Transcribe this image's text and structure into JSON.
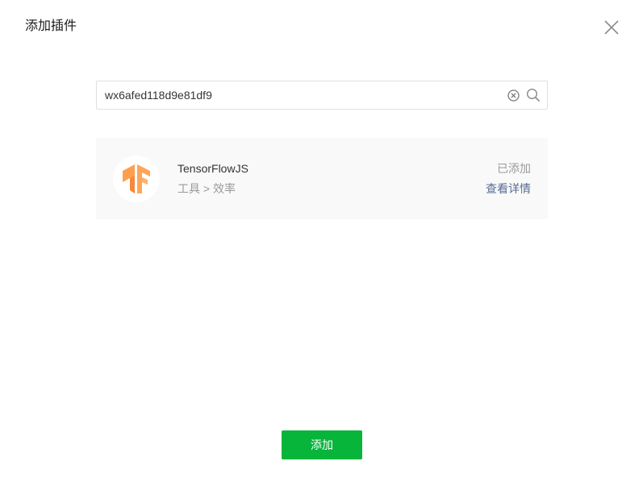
{
  "dialog": {
    "title": "添加插件",
    "close_icon": "close-icon"
  },
  "search": {
    "value": "wx6afed118d9e81df9",
    "clear_icon": "clear-circle-icon",
    "search_icon": "search-icon"
  },
  "result": {
    "logo_icon": "tensorflow-logo",
    "name": "TensorFlowJS",
    "category": "工具 > 效率",
    "status": "已添加",
    "detail_link": "查看详情"
  },
  "footer": {
    "add_label": "添加"
  },
  "colors": {
    "primary_green": "#07b53b",
    "link_blue": "#576b95",
    "logo_orange": "#ff9e4e"
  }
}
